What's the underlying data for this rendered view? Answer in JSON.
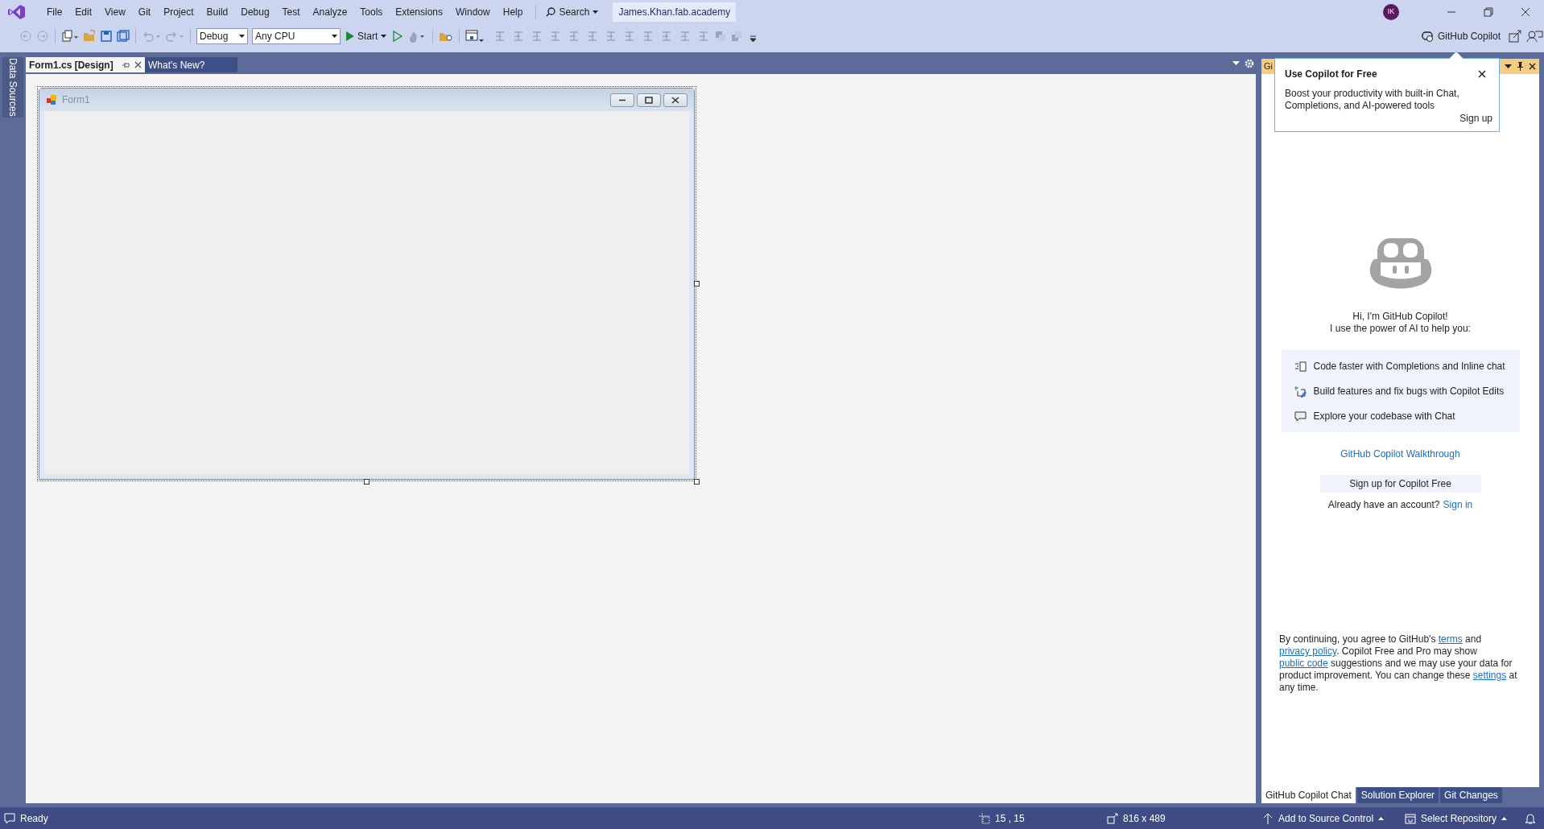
{
  "menu": [
    "File",
    "Edit",
    "View",
    "Git",
    "Project",
    "Build",
    "Debug",
    "Test",
    "Analyze",
    "Tools",
    "Extensions",
    "Window",
    "Help"
  ],
  "search": "Search",
  "account": "James.Khan.fab.academy",
  "avatar": "IK",
  "toolbar": {
    "configuration": "Debug",
    "platform": "Any CPU",
    "start": "Start"
  },
  "copilot_button": "GitHub Copilot",
  "side_tab": "Data Sources",
  "document_tabs": [
    {
      "label": "Form1.cs [Design]",
      "selected": true
    },
    {
      "label": "What's New?",
      "selected": false
    }
  ],
  "designer": {
    "form_title": "Form1"
  },
  "panel": {
    "title": "Gi",
    "greeting": [
      "Hi, I'm GitHub Copilot!",
      "I use the power of AI to help you:"
    ],
    "features": [
      "Code faster with Completions and Inline chat",
      "Build features and fix bugs with Copilot Edits",
      "Explore your codebase with Chat"
    ],
    "walkthrough_link": "GitHub Copilot Walkthrough",
    "signup_button": "Sign up for Copilot Free",
    "account_prompt": "Already have an account?",
    "sign_in_link": "Sign in",
    "legal": [
      {
        "kind": "text",
        "text": "By continuing, you agree to GitHub's "
      },
      {
        "kind": "link",
        "text": "terms"
      },
      {
        "kind": "text",
        "text": " and "
      },
      {
        "kind": "link",
        "text": "privacy policy"
      },
      {
        "kind": "text",
        "text": ". Copilot Free and Pro may show "
      },
      {
        "kind": "link",
        "text": "public code"
      },
      {
        "kind": "text",
        "text": " suggestions and we may use your data for product improvement. You can change these "
      },
      {
        "kind": "link",
        "text": "settings"
      },
      {
        "kind": "text",
        "text": " at any time."
      }
    ]
  },
  "popup": {
    "title": "Use Copilot for Free",
    "body": "Boost your productivity with built-in Chat, Completions, and AI-powered tools",
    "action": "Sign up"
  },
  "panel_tabs": [
    {
      "label": "GitHub Copilot Chat",
      "selected": true
    },
    {
      "label": "Solution Explorer",
      "selected": false
    },
    {
      "label": "Git Changes",
      "selected": false
    }
  ],
  "status_bar": {
    "status": "Ready",
    "position": "15 , 15",
    "size": "816 x 489",
    "source_control": "Add to Source Control",
    "repository": "Select Repository"
  }
}
